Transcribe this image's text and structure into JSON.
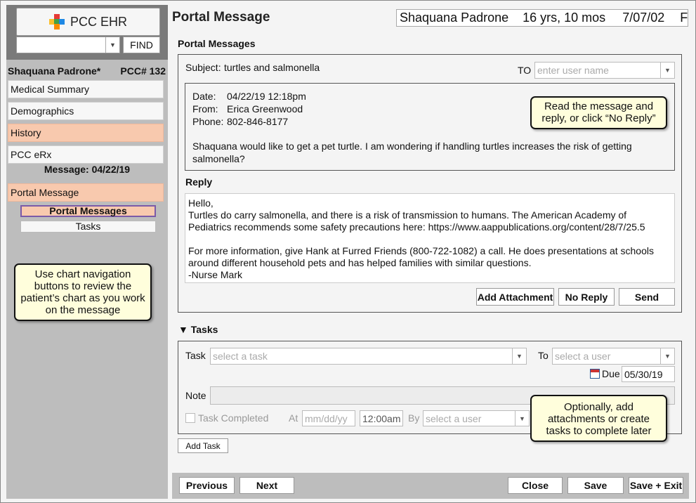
{
  "app": {
    "logo_label": "PCC EHR",
    "find_label": "FIND",
    "search_value": ""
  },
  "patient": {
    "name_short": "Shaquana Padrone*",
    "pcc_number": "PCC# 132",
    "banner_name": "Shaquana Padrone",
    "banner_age": "16 yrs, 10 mos",
    "banner_dob": "7/07/02",
    "banner_sex": "F"
  },
  "sidebar": {
    "items": [
      {
        "label": "Medical Summary"
      },
      {
        "label": "Demographics"
      },
      {
        "label": "History"
      },
      {
        "label": "PCC eRx"
      }
    ],
    "message_header": "Message: 04/22/19",
    "portal_item": "Portal Message",
    "sub_items": [
      {
        "label": "Portal Messages"
      },
      {
        "label": "Tasks"
      }
    ],
    "callout": "Use chart navigation buttons to review the patient’s chart as you work on the message"
  },
  "main": {
    "page_title": "Portal Message",
    "section_title": "Portal Messages",
    "subject_label": "Subject:",
    "subject_value": "turtles and salmonella",
    "to_label": "TO",
    "to_placeholder": "enter user name",
    "message": {
      "date_label": "Date:",
      "date_value": "04/22/19 12:18pm",
      "from_label": "From:",
      "from_value": "Erica Greenwood",
      "phone_label": "Phone:",
      "phone_value": "802-846-8177",
      "body": "Shaquana would like to get a pet turtle. I am wondering if handling turtles increases the risk of getting salmonella?"
    },
    "message_callout": "Read the message and reply, or click “No Reply”",
    "reply_label": "Reply",
    "reply_text": "Hello,\nTurtles do carry salmonella, and there is a risk of transmission to humans. The American Academy of Pediatrics recommends some safety precautions here: https://www.aappublications.org/content/28/7/25.5\n\nFor more information, give Hank at Furred Friends (800-722-1082) a call. He does presentations at schools around different household pets and has helped families with similar questions.\n-Nurse Mark",
    "buttons": {
      "add_attachment": "Add Attachment",
      "no_reply": "No Reply",
      "send": "Send"
    }
  },
  "tasks": {
    "title": "▼ Tasks",
    "task_label": "Task",
    "task_placeholder": "select a task",
    "to_label": "To",
    "to_placeholder": "select a user",
    "due_label": "Due",
    "due_value": "05/30/19",
    "note_label": "Note",
    "completed_label": "Task Completed",
    "at_label": "At",
    "date_placeholder": "mm/dd/yy",
    "time_value": "12:00am",
    "by_label": "By",
    "by_placeholder": "select a user",
    "add_task": "Add Task",
    "callout": "Optionally, add attachments or create tasks to complete later"
  },
  "footer": {
    "previous": "Previous",
    "next": "Next",
    "close": "Close",
    "save": "Save",
    "save_exit": "Save + Exit"
  },
  "colors": {
    "highlight": "#f8c9ae",
    "callout_bg": "#fffedc",
    "sidebar_bg": "#bdbdbd",
    "active_border": "#7b5aa8"
  }
}
